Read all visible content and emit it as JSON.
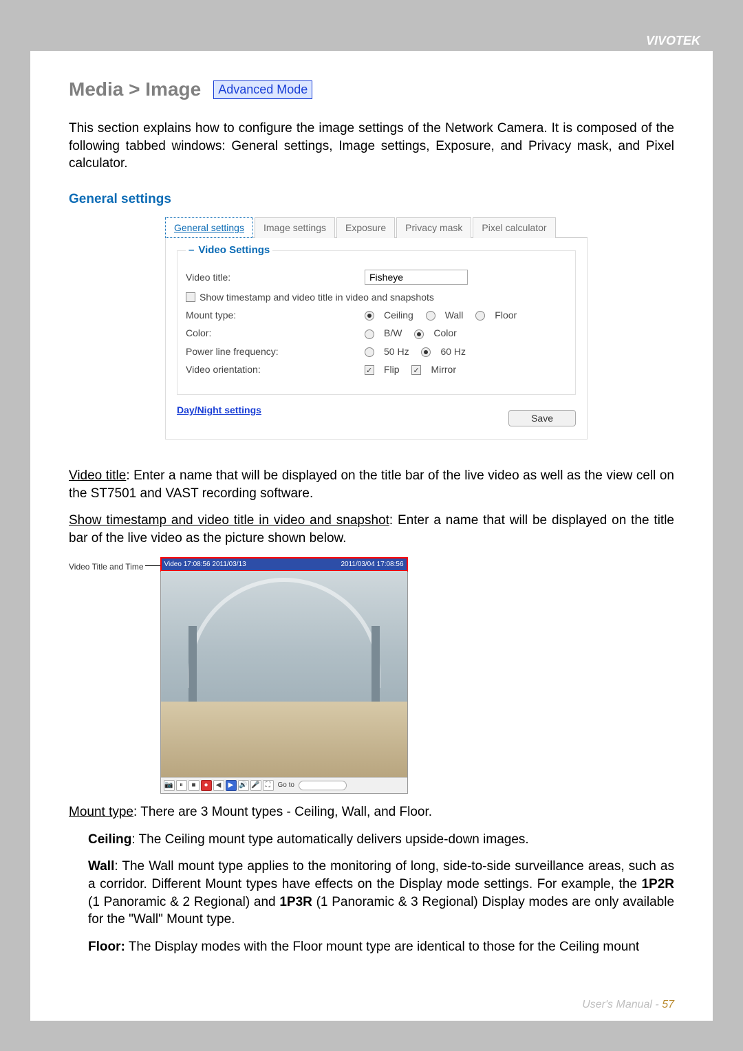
{
  "brand": "VIVOTEK",
  "title": "Media > Image",
  "advanced_badge": "Advanced Mode",
  "intro": "This section explains how to configure the image settings of the Network Camera. It is composed of the following tabbed windows: General settings, Image settings, Exposure, and Privacy mask, and Pixel calculator.",
  "section_heading": "General settings",
  "tabs": {
    "general": "General settings",
    "image": "Image settings",
    "exposure": "Exposure",
    "privacy": "Privacy mask",
    "pixel": "Pixel calculator"
  },
  "fieldset_legend": "Video Settings",
  "form": {
    "video_title_label": "Video title:",
    "video_title_value": "Fisheye",
    "show_timestamp_label": "Show timestamp and video title in video and snapshots",
    "mount_label": "Mount type:",
    "mount_opts": {
      "ceiling": "Ceiling",
      "wall": "Wall",
      "floor": "Floor"
    },
    "color_label": "Color:",
    "color_opts": {
      "bw": "B/W",
      "color": "Color"
    },
    "plf_label": "Power line frequency:",
    "plf_opts": {
      "f50": "50 Hz",
      "f60": "60 Hz"
    },
    "orient_label": "Video orientation:",
    "orient_opts": {
      "flip": "Flip",
      "mirror": "Mirror"
    },
    "daynight_link": "Day/Night settings",
    "save": "Save"
  },
  "para": {
    "vt_head": "Video title",
    "vt_body": ": Enter a name that will be displayed on the title bar of the live video as well as the view cell on the ST7501 and VAST recording software.",
    "st_head": "Show timestamp and video title in video and snapshot",
    "st_body": ": Enter a name that will be displayed on the title bar of the live video as the picture shown below.",
    "fig_label": "Video Title and Time",
    "fig_overlay_left": "Video 17:08:56 2011/03/13",
    "fig_overlay_right": "2011/03/04 17:08:56",
    "mt_head": "Mount type",
    "mt_body": ": There are 3 Mount types - Ceiling, Wall, and Floor.",
    "ceiling_head": "Ceiling",
    "ceiling_body": ": The Ceiling mount type automatically delivers upside-down images.",
    "wall_head": "Wall",
    "wall_body": ": The Wall mount type applies to the monitoring of long, side-to-side surveillance areas, such as a corridor. Different Mount types have effects on the Display mode settings. For example, the ",
    "wall_bold1": "1P2R",
    "wall_mid": " (1 Panoramic & 2 Regional) and ",
    "wall_bold2": "1P3R",
    "wall_end": " (1 Panoramic & 3 Regional) Display modes are only available for the \"Wall\" Mount type.",
    "floor_head": "Floor:",
    "floor_body": " The Display modes with the Floor mount type are identical to those for the Ceiling mount"
  },
  "controls_goto": "Go to",
  "footer": {
    "text": "User's Manual - ",
    "page": "57"
  }
}
